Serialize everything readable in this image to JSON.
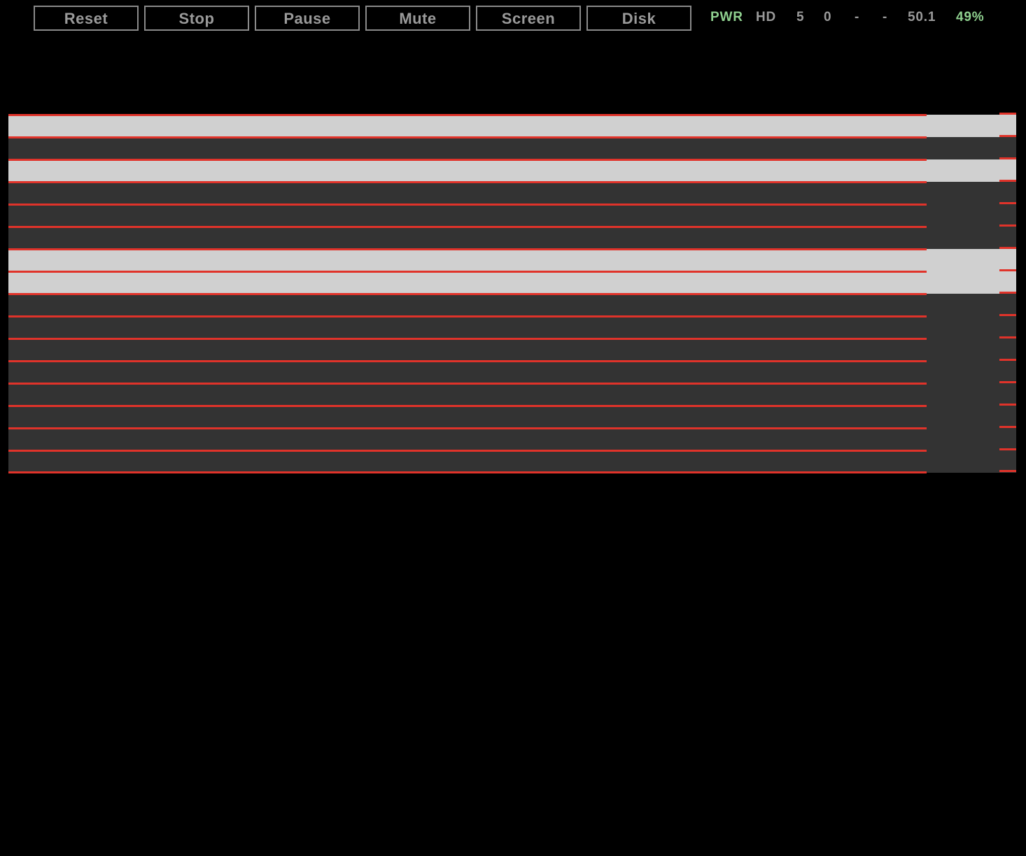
{
  "toolbar": {
    "buttons": [
      "Reset",
      "Stop",
      "Pause",
      "Mute",
      "Screen",
      "Disk"
    ],
    "status": {
      "pwr": "PWR",
      "hd": "HD",
      "val1": "5",
      "val2": "0",
      "val3": "-",
      "val4": "-",
      "speed": "50.1",
      "percent": "49%"
    }
  },
  "colors": {
    "background": "#000000",
    "screen_dark": "#333333",
    "screen_lit": "#d0d0d0",
    "line_red": "#e0332a",
    "status_green": "#8fd08f",
    "text_gray": "#9a9a9a"
  },
  "screen": {
    "row_states": [
      "lit",
      "dark",
      "lit",
      "dark",
      "dark",
      "dark",
      "lit",
      "lit",
      "dark",
      "dark",
      "dark",
      "dark",
      "dark",
      "dark",
      "dark",
      "dark"
    ]
  }
}
